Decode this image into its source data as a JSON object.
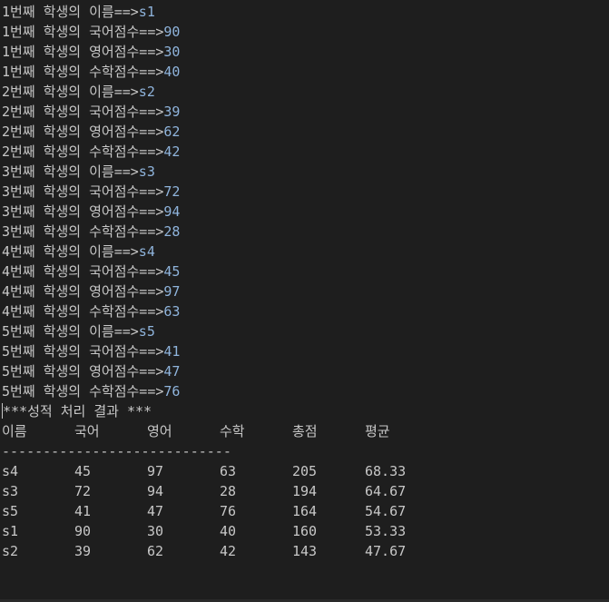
{
  "input_lines": [
    {
      "prompt": "1번째 학생의 이름==>",
      "value": "s1"
    },
    {
      "prompt": "1번째 학생의 국어점수==>",
      "value": "90"
    },
    {
      "prompt": "1번째 학생의 영어점수==>",
      "value": "30"
    },
    {
      "prompt": "1번째 학생의 수학점수==>",
      "value": "40"
    },
    {
      "prompt": "2번째 학생의 이름==>",
      "value": "s2"
    },
    {
      "prompt": "2번째 학생의 국어점수==>",
      "value": "39"
    },
    {
      "prompt": "2번째 학생의 영어점수==>",
      "value": "62"
    },
    {
      "prompt": "2번째 학생의 수학점수==>",
      "value": "42"
    },
    {
      "prompt": "3번째 학생의 이름==>",
      "value": "s3"
    },
    {
      "prompt": "3번째 학생의 국어점수==>",
      "value": "72"
    },
    {
      "prompt": "3번째 학생의 영어점수==>",
      "value": "94"
    },
    {
      "prompt": "3번째 학생의 수학점수==>",
      "value": "28"
    },
    {
      "prompt": "4번째 학생의 이름==>",
      "value": "s4"
    },
    {
      "prompt": "4번째 학생의 국어점수==>",
      "value": "45"
    },
    {
      "prompt": "4번째 학생의 영어점수==>",
      "value": "97"
    },
    {
      "prompt": "4번째 학생의 수학점수==>",
      "value": "63"
    },
    {
      "prompt": "5번째 학생의 이름==>",
      "value": "s5"
    },
    {
      "prompt": "5번째 학생의 국어점수==>",
      "value": "41"
    },
    {
      "prompt": "5번째 학생의 영어점수==>",
      "value": "47"
    },
    {
      "prompt": "5번째 학생의 수학점수==>",
      "value": "76"
    }
  ],
  "result_title": "***성적 처리 결과 ***",
  "table": {
    "headers": [
      "이름",
      "국어",
      "영어",
      "수학",
      "총점",
      "평균"
    ],
    "divider": "----------------------------",
    "rows": [
      [
        "s4",
        "45",
        "97",
        "63",
        "205",
        "68.33"
      ],
      [
        "s3",
        "72",
        "94",
        "28",
        "194",
        "64.67"
      ],
      [
        "s5",
        "41",
        "47",
        "76",
        "164",
        "54.67"
      ],
      [
        "s1",
        "90",
        "30",
        "40",
        "160",
        "53.33"
      ],
      [
        "s2",
        "39",
        "62",
        "42",
        "143",
        "47.67"
      ]
    ]
  },
  "colors": {
    "background": "#1e1e1e",
    "text": "#c7c7c7",
    "input": "#8fb4dc"
  }
}
